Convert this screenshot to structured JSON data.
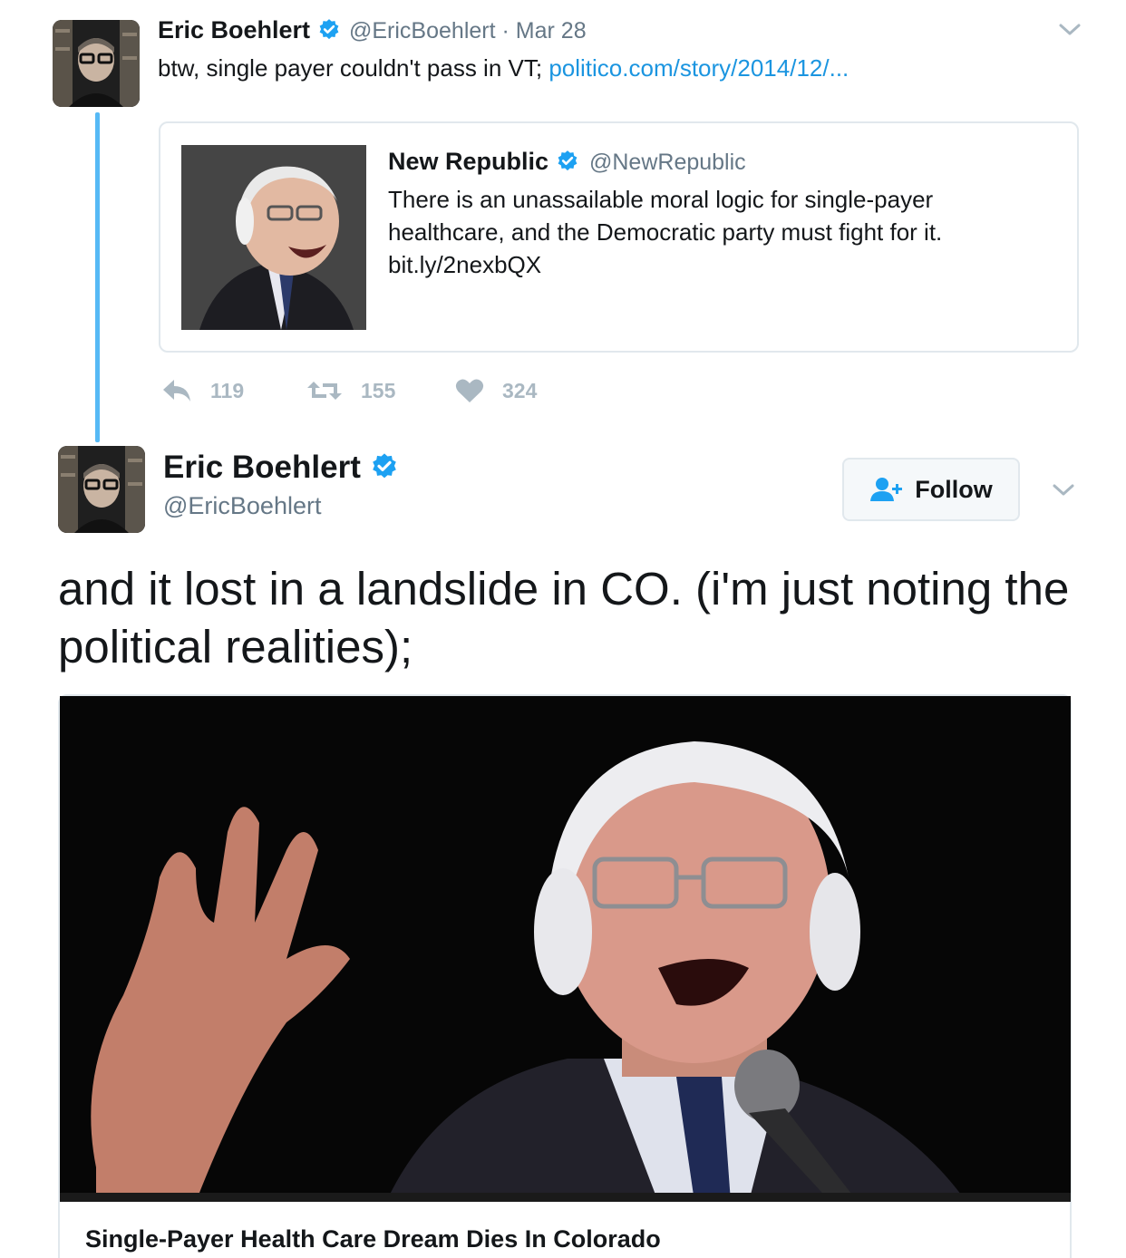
{
  "colors": {
    "accent": "#1da1f2",
    "link": "#1b95e0",
    "muted": "#657786",
    "action": "#aab8c2",
    "border": "#e1e8ed"
  },
  "tweet1": {
    "author_name": "Eric Boehlert",
    "author_handle": "@EricBoehlert",
    "separator": "·",
    "date": "Mar 28",
    "text": "btw, single payer couldn't pass in VT;",
    "link": "politico.com/story/2014/12/...",
    "quoted": {
      "author_name": "New Republic",
      "author_handle": "@NewRepublic",
      "text_line1": "There is an unassailable moral logic for single-payer",
      "text_line2": "healthcare, and the Democratic party must fight for it.",
      "text_line3": "bit.ly/2nexbQX"
    },
    "actions": {
      "replies": "119",
      "retweets": "155",
      "likes": "324"
    }
  },
  "tweet2": {
    "author_name": "Eric Boehlert",
    "author_handle": "@EricBoehlert",
    "follow_label": "Follow",
    "text": "and it lost in a landslide in CO. (i'm just noting the political realities);",
    "card": {
      "title": "Single-Payer Health Care Dream Dies In Colorado"
    }
  },
  "icons": {
    "verified": "verified-badge-icon",
    "caret": "chevron-down-icon",
    "reply": "reply-icon",
    "retweet": "retweet-icon",
    "like": "heart-icon",
    "follow": "add-user-icon"
  }
}
